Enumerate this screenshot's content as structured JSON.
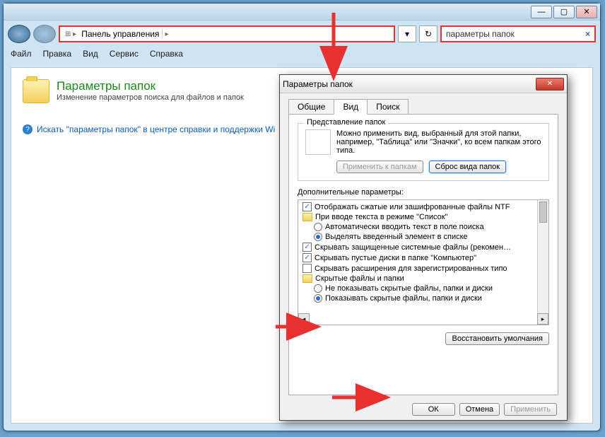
{
  "outer": {
    "min": "—",
    "max": "▢",
    "close": "✕",
    "breadcrumb_icon": "▸",
    "breadcrumb_text": "Панель управления",
    "refresh": "↻",
    "search_value": "параметры папок",
    "search_clear": "×",
    "menu": [
      "Файл",
      "Правка",
      "Вид",
      "Сервис",
      "Справка"
    ]
  },
  "page": {
    "title": "Параметры папок",
    "subtitle": "Изменение параметров поиска для файлов и папок",
    "help_text": "Искать \"параметры папок\" в центре справки и поддержки Wi",
    "help_q": "?"
  },
  "dlg": {
    "title": "Параметры папок",
    "close": "✕",
    "tabs": {
      "t0": "Общие",
      "t1": "Вид",
      "t2": "Поиск"
    },
    "group_title": "Представление папок",
    "group_desc": "Можно применить вид, выбранный для этой папки, например, \"Таблица\" или \"Значки\", ко всем папкам этого типа.",
    "apply_folders": "Применить к папкам",
    "reset_folders": "Сброс вида папок",
    "adv_label": "Дополнительные параметры:",
    "items": {
      "i0": "Отображать сжатые или зашифрованные файлы NTF",
      "i1": "При вводе текста в режиме \"Список\"",
      "i1a": "Автоматически вводить текст в поле поиска",
      "i1b": "Выделять введенный элемент в списке",
      "i2": "Скрывать защищенные системные файлы (рекомен…",
      "i3": "Скрывать пустые диски в папке \"Компьютер\"",
      "i4": "Скрывать расширения для зарегистрированных типо",
      "i5": "Скрытые файлы и папки",
      "i5a": "Не показывать скрытые файлы, папки и диски",
      "i5b": "Показывать скрытые файлы, папки и диски"
    },
    "restore": "Восстановить умолчания",
    "ok": "ОК",
    "cancel": "Отмена",
    "apply": "Применить"
  }
}
